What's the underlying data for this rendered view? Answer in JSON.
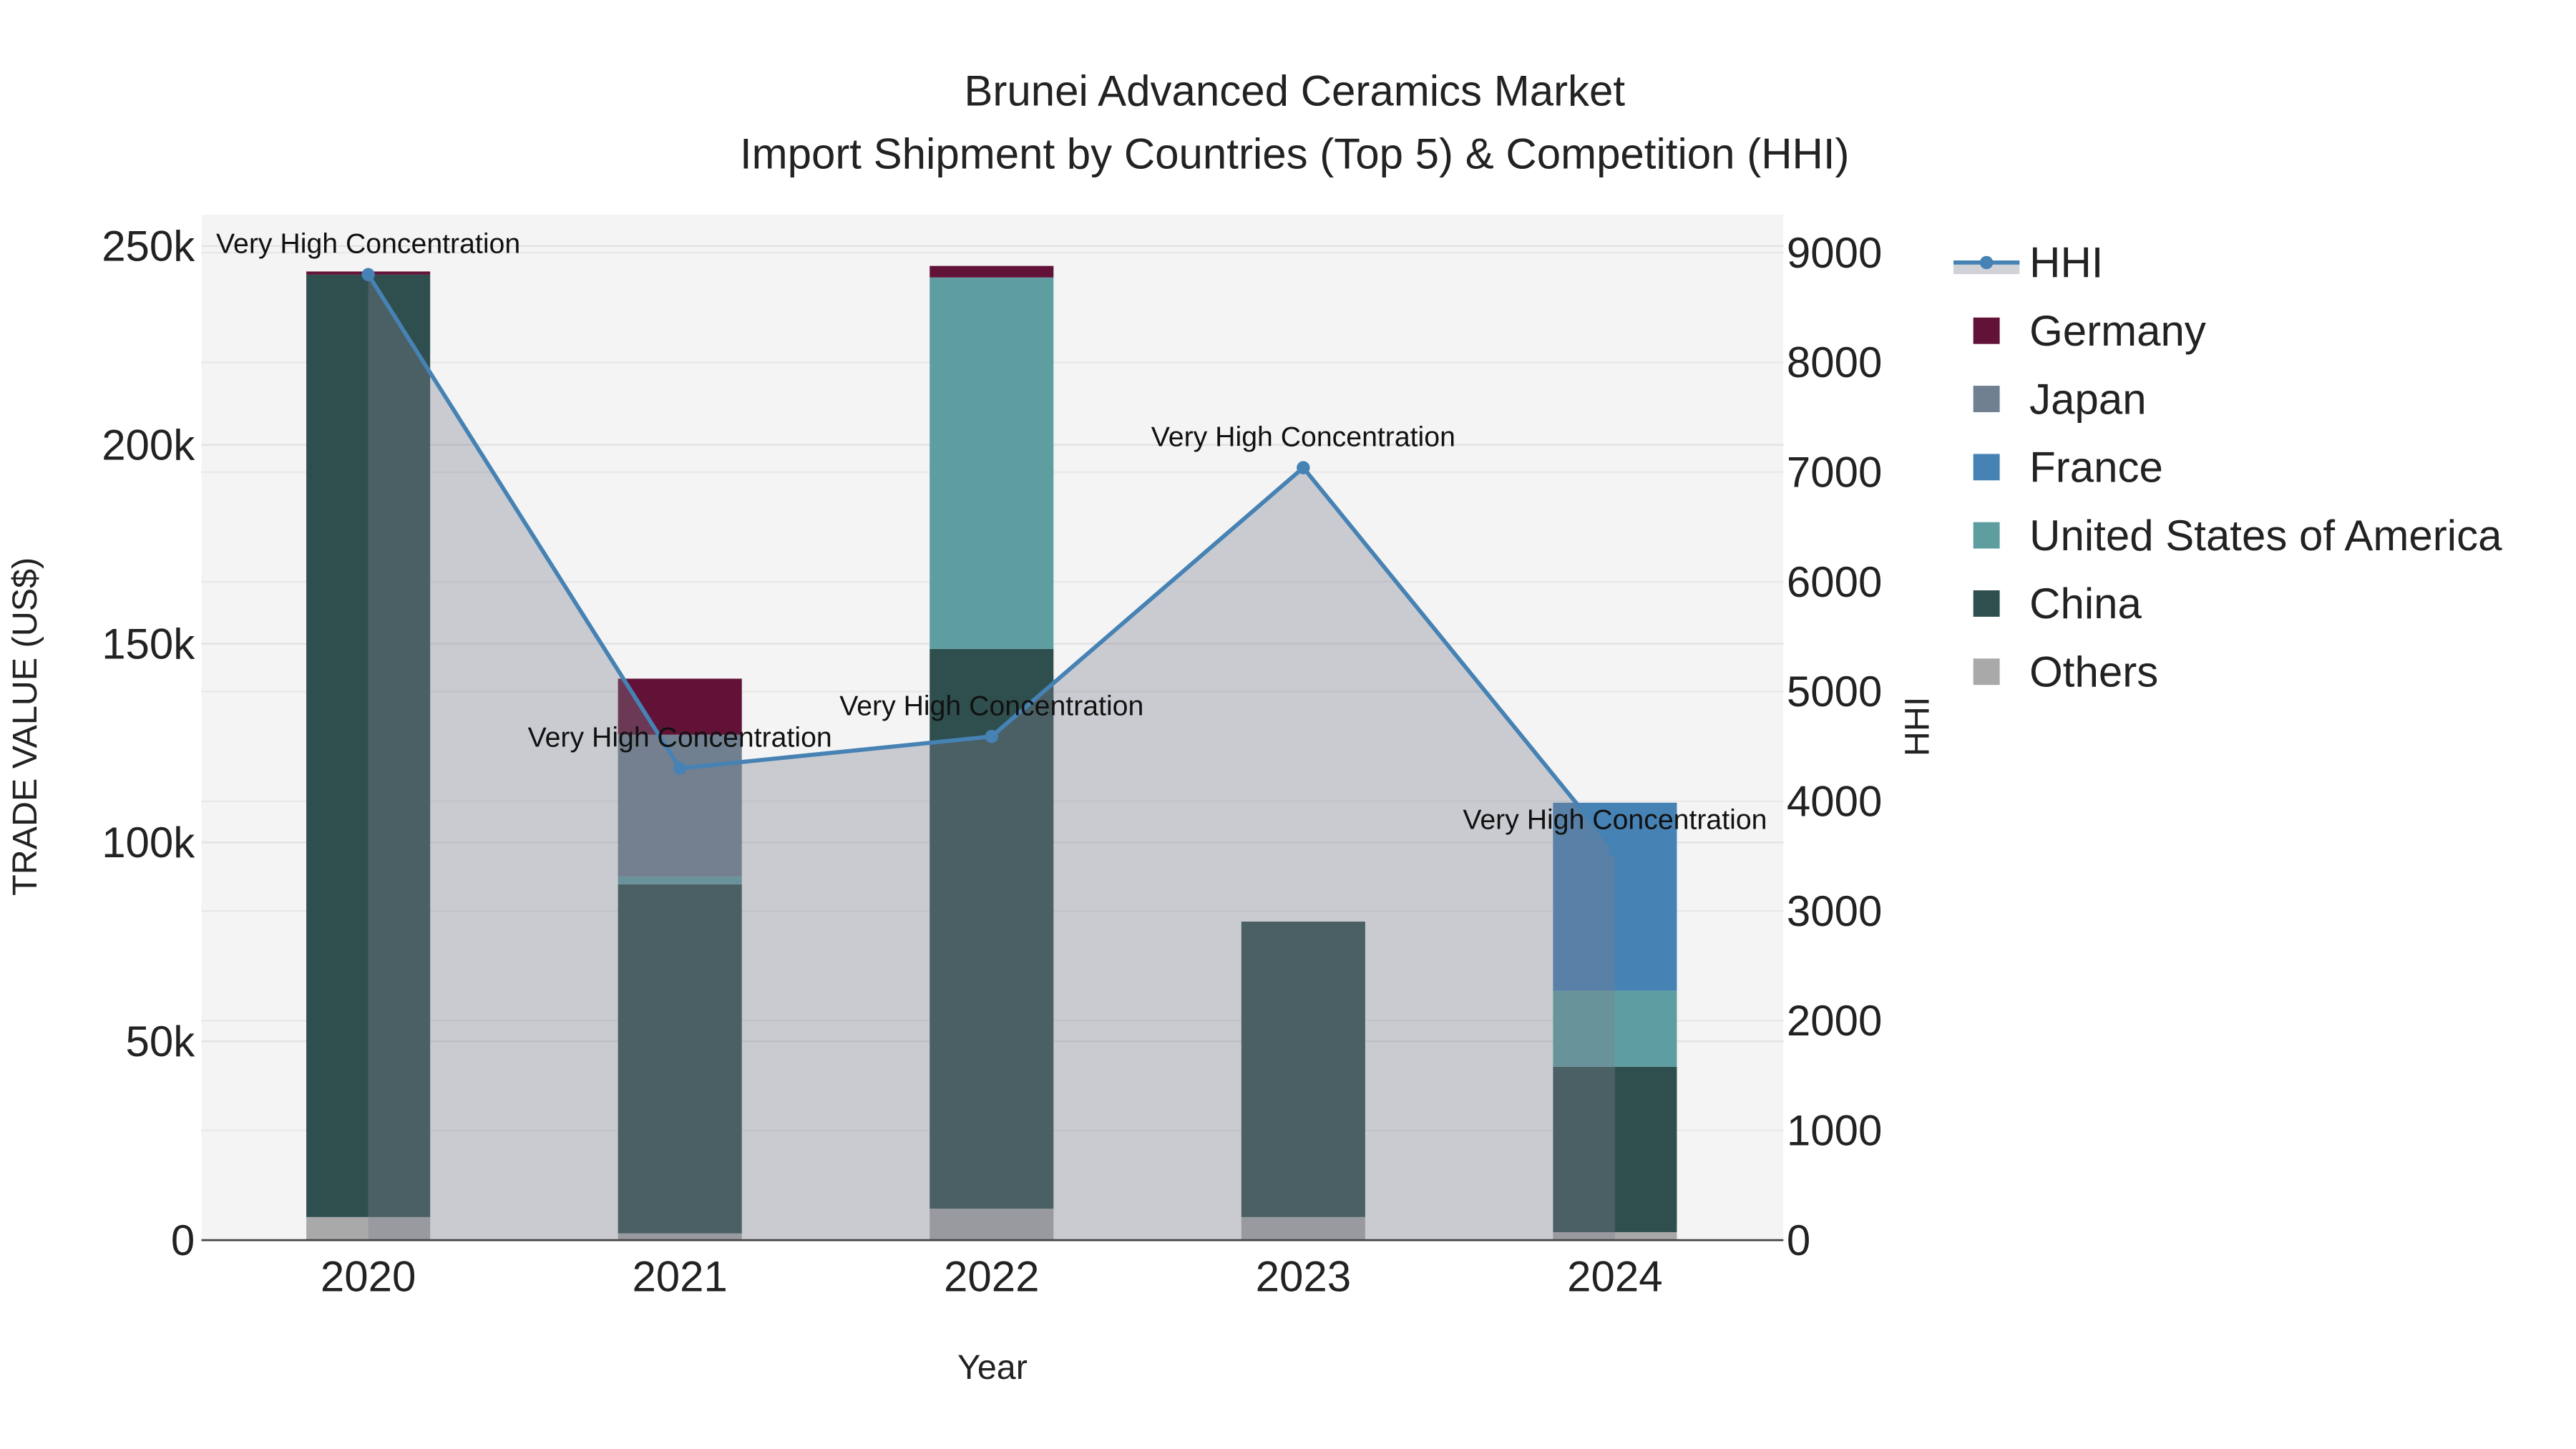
{
  "chart_data": {
    "type": "bar",
    "barmode": "stack",
    "title_line1": "Brunei Advanced Ceramics Market",
    "title_line2": "Import Shipment by Countries (Top 5) & Competition (HHI)",
    "xlabel": "Year",
    "ylabel": "TRADE VALUE (US$)",
    "y2label": "HHI",
    "categories": [
      "2020",
      "2021",
      "2022",
      "2023",
      "2024"
    ],
    "ylim": [
      0,
      250000
    ],
    "y2lim": [
      0,
      9000
    ],
    "yticks": [
      {
        "v": 0,
        "label": "0"
      },
      {
        "v": 50000,
        "label": "50k"
      },
      {
        "v": 100000,
        "label": "100k"
      },
      {
        "v": 150000,
        "label": "150k"
      },
      {
        "v": 200000,
        "label": "200k"
      },
      {
        "v": 250000,
        "label": "250k"
      }
    ],
    "y2ticks": [
      "0",
      "1000",
      "2000",
      "3000",
      "4000",
      "5000",
      "6000",
      "7000",
      "8000",
      "9000"
    ],
    "series": [
      {
        "name": "Others",
        "color": "#a9a9a9",
        "values": [
          5800,
          1700,
          7900,
          5800,
          2000
        ]
      },
      {
        "name": "China",
        "color": "#2f4f4f",
        "values": [
          237000,
          87800,
          140800,
          74300,
          41600
        ]
      },
      {
        "name": "United States of America",
        "color": "#5f9ea0",
        "values": [
          0,
          1900,
          93400,
          0,
          19100
        ]
      },
      {
        "name": "France",
        "color": "#4682b4",
        "values": [
          0,
          0,
          0,
          0,
          47300
        ]
      },
      {
        "name": "Japan",
        "color": "#708090",
        "values": [
          0,
          35700,
          0,
          0,
          0
        ]
      },
      {
        "name": "Germany",
        "color": "#621237",
        "values": [
          800,
          14100,
          2900,
          0,
          0
        ]
      }
    ],
    "hhi": {
      "name": "HHI",
      "color": "#4682b4",
      "values": [
        8800,
        4300,
        4590,
        7040,
        3550
      ],
      "annotations": [
        "Very High Concentration",
        "Very High Concentration",
        "Very High Concentration",
        "Very High Concentration",
        "Very High Concentration"
      ]
    },
    "legend": {
      "placement": "right",
      "order": [
        "HHI",
        "Germany",
        "Japan",
        "France",
        "United States of America",
        "China",
        "Others"
      ]
    }
  }
}
